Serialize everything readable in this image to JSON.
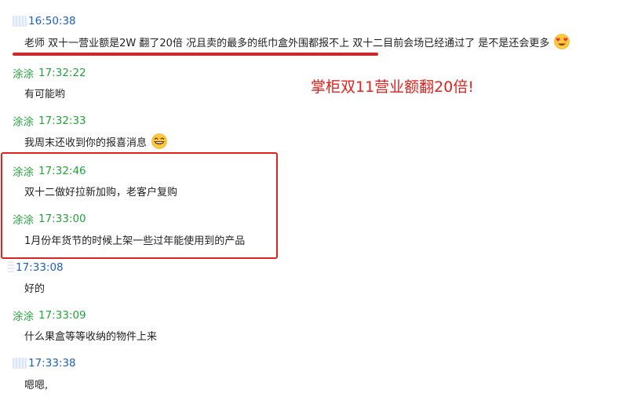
{
  "messages": [
    {
      "sender": "",
      "time": "16:50:38",
      "text": "老师 双十一营业额是2W 翻了20倍 况且卖的最多的纸巾盒外围都报不上 双十二目前会场已经通过了 是不是还会更多",
      "emoji": "heart-eyes-emoji"
    },
    {
      "sender": "涂涂",
      "time": "17:32:22",
      "text": "有可能哟"
    },
    {
      "sender": "涂涂",
      "time": "17:32:33",
      "text": "我周末还收到你的报喜消息",
      "emoji": "grinning-emoji"
    },
    {
      "sender": "涂涂",
      "time": "17:32:46",
      "text": "双十二做好拉新加购，老客户复购"
    },
    {
      "sender": "涂涂",
      "time": "17:33:00",
      "text": "1月份年货节的时候上架一些过年能使用到的产品"
    },
    {
      "sender": "",
      "time": "17:33:08",
      "text": "好的"
    },
    {
      "sender": "涂涂",
      "time": "17:33:09",
      "text": "什么果盒等等收纳的物件上来"
    },
    {
      "sender": "",
      "time": "17:33:38",
      "text": "嗯嗯,"
    }
  ],
  "annotation": {
    "text": "掌柜双11营业额翻20倍!"
  },
  "colors": {
    "me_header": "#1a5fc8",
    "other_header": "#22a33a",
    "annotation": "#e0221e",
    "body_text": "#222222"
  }
}
